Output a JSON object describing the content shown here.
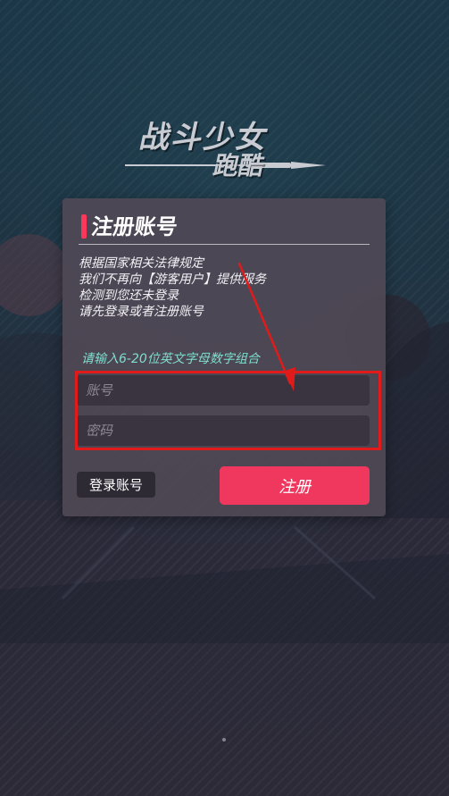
{
  "colors": {
    "accent_red": "#ff365c",
    "register_button": "#f0385f",
    "hint_green": "#7fdccd",
    "panel_bg": "#4e4854",
    "annotation_red": "#e11a1a"
  },
  "logo": {
    "title": "战斗少女",
    "subtitle": "跑酷"
  },
  "panel": {
    "title": "注册账号",
    "notice_lines": [
      "根据国家相关法律规定",
      "我们不再向【游客用户】提供服务",
      "检测到您还未登录",
      "请先登录或者注册账号"
    ],
    "hint": "请输入6-20位英文字母数字组合",
    "account_placeholder": "账号",
    "password_placeholder": "密码",
    "login_button": "登录账号",
    "register_button": "注册"
  },
  "icons": {
    "title_marker": "vertical-bar-icon",
    "annotation_arrow": "arrow-icon"
  }
}
